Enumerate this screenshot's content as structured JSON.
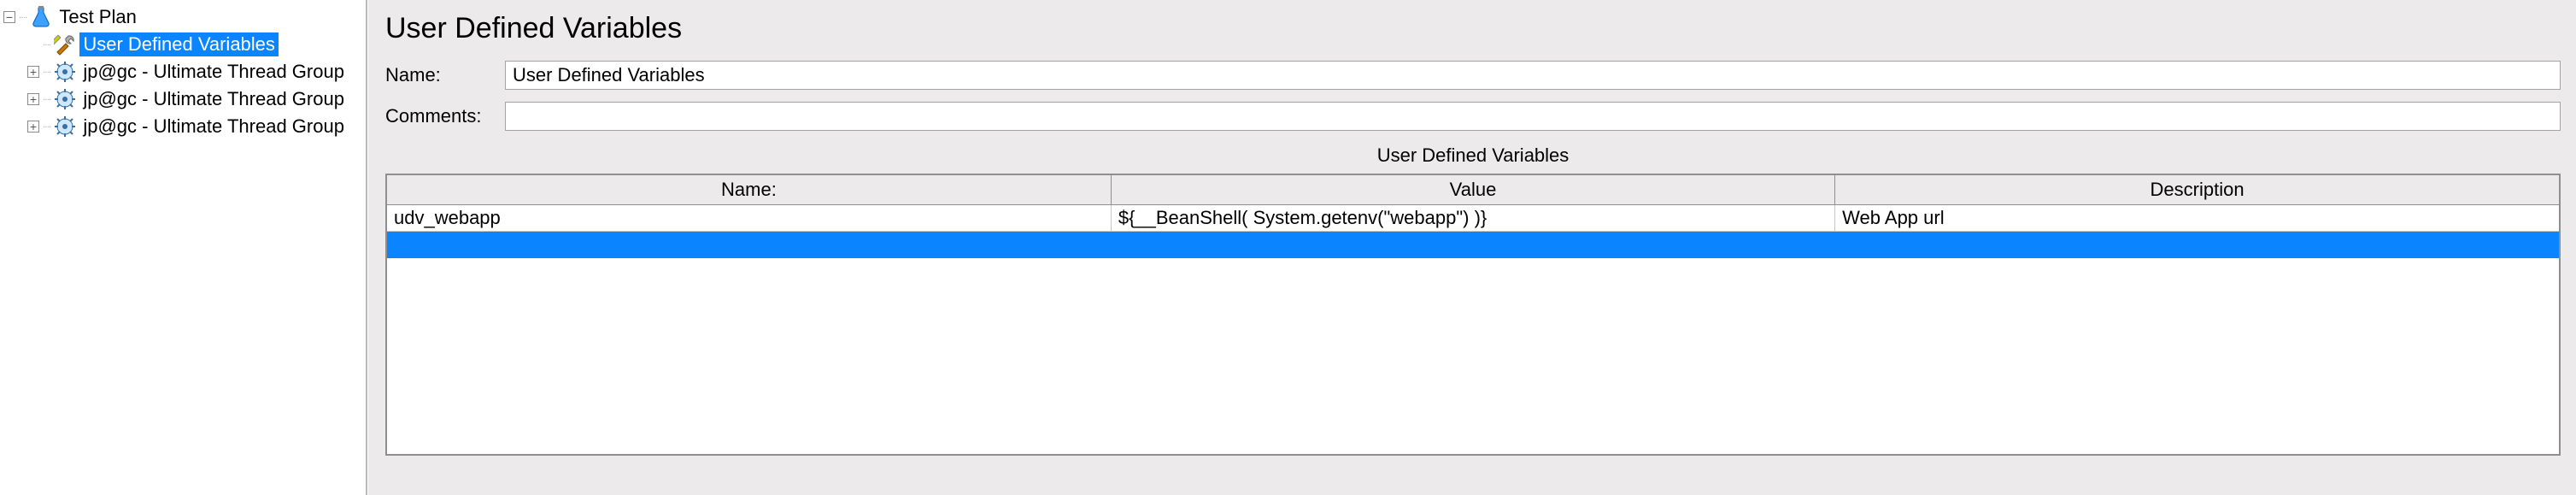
{
  "tree": {
    "root_label": "Test Plan",
    "items": [
      {
        "label": "User Defined Variables",
        "selected": true,
        "expander": "none",
        "icon": "tools"
      },
      {
        "label": "jp@gc - Ultimate Thread Group",
        "selected": false,
        "expander": "plus",
        "icon": "gear"
      },
      {
        "label": "jp@gc - Ultimate Thread Group",
        "selected": false,
        "expander": "plus",
        "icon": "gear"
      },
      {
        "label": "jp@gc - Ultimate Thread Group",
        "selected": false,
        "expander": "plus",
        "icon": "gear"
      }
    ]
  },
  "main": {
    "title": "User Defined Variables",
    "name_label": "Name:",
    "name_value": "User Defined Variables",
    "comments_label": "Comments:",
    "comments_value": "",
    "section_caption": "User Defined Variables",
    "columns": {
      "name": "Name:",
      "value": "Value",
      "desc": "Description"
    },
    "rows": [
      {
        "name": "udv_webapp",
        "value": "${__BeanShell( System.getenv(\"webapp\") )}",
        "desc": "Web App url"
      }
    ]
  }
}
